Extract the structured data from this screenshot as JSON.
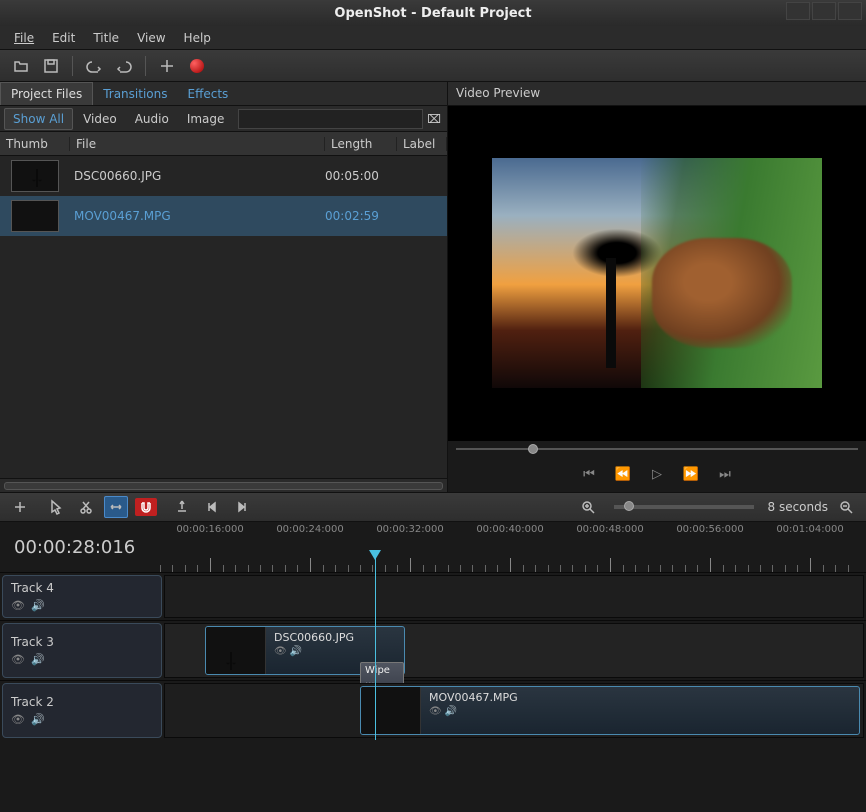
{
  "title": "OpenShot - Default Project",
  "menu": {
    "file": "File",
    "edit": "Edit",
    "title": "Title",
    "view": "View",
    "help": "Help"
  },
  "tabs": {
    "project_files": "Project Files",
    "transitions": "Transitions",
    "effects": "Effects"
  },
  "filter": {
    "show_all": "Show All",
    "video": "Video",
    "audio": "Audio",
    "image": "Image",
    "search_placeholder": ""
  },
  "file_cols": {
    "thumb": "Thumb",
    "file": "File",
    "length": "Length",
    "label": "Label"
  },
  "files": [
    {
      "name": "DSC00660.JPG",
      "length": "00:05:00",
      "label": ""
    },
    {
      "name": "MOV00467.MPG",
      "length": "00:02:59",
      "label": ""
    }
  ],
  "preview": {
    "title": "Video Preview"
  },
  "timeline": {
    "current_time": "00:00:28:016",
    "zoom_label": "8 seconds",
    "ruler_marks": [
      "00:00:16:000",
      "00:00:24:000",
      "00:00:32:000",
      "00:00:40:000",
      "00:00:48:000",
      "00:00:56:000",
      "00:01:04:000"
    ],
    "tracks": [
      {
        "name": "Track 4"
      },
      {
        "name": "Track 3"
      },
      {
        "name": "Track 2"
      }
    ],
    "clips": {
      "track3": {
        "name": "DSC00660.JPG"
      },
      "track2": {
        "name": "MOV00467.MPG"
      }
    },
    "transition": {
      "label": "Wipe ..."
    }
  }
}
